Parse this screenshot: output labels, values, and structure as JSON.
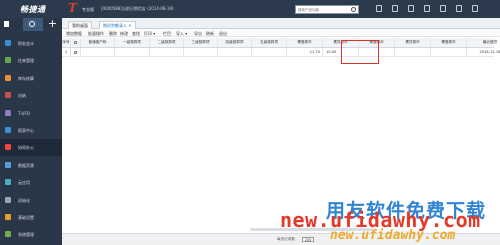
{
  "app": {
    "logo_text": "畅捷通",
    "logo_mark": "T",
    "edition": "专业版",
    "account_info": "[0000588]当前日期用友  (2014-08-19)"
  },
  "search": {
    "placeholder": "搜索产品功能"
  },
  "sidebar": {
    "items": [
      {
        "label": "财务会计",
        "color": "#3c8fd6"
      },
      {
        "label": "往来管理",
        "color": "#6aa84f"
      },
      {
        "label": "库存核算",
        "color": "#e69138"
      },
      {
        "label": "出纳",
        "color": "#c94e4e"
      },
      {
        "label": "T-UFO",
        "color": "#8e7cc3"
      },
      {
        "label": "报表中心",
        "color": "#3c8fd6"
      },
      {
        "label": "协同办公",
        "color": "#ee4444"
      },
      {
        "label": "数据资源",
        "color": "#5b9bd5"
      },
      {
        "label": "云应用",
        "color": "#4bacc6"
      },
      {
        "label": "初始化",
        "color": "#9aa6b2"
      },
      {
        "label": "基础设置",
        "color": "#e0a020"
      },
      {
        "label": "系统管理",
        "color": "#70ad47"
      }
    ]
  },
  "tabs": [
    {
      "label": "我的桌面",
      "active": false
    },
    {
      "label": "期初余额录入 ×",
      "active": true
    }
  ],
  "toolbar": {
    "items": [
      "增加数据",
      "批量操作",
      "删除",
      "修改",
      "查找",
      "打印 ▾",
      "栏目",
      "导入 ▾",
      "导出",
      "刷新",
      "退出"
    ]
  },
  "table": {
    "headers": [
      "序号",
      "",
      "普通客户码",
      "一级核算项",
      "二级核算项",
      "三级核算项",
      "四级核算项",
      "五级核算项",
      "累借原币",
      "累贷原币",
      "累借原币",
      "累贷原币",
      "累借原币",
      "最近借贷"
    ],
    "rows": [
      [
        "1",
        "",
        "",
        "",
        "",
        "",
        "",
        "",
        "11.70",
        "10.00",
        "",
        "",
        "",
        "2016-12-16"
      ]
    ]
  },
  "footer": {
    "page_label": "每页记录数",
    "page_size": "200"
  },
  "watermark": {
    "line1": "用友软件免费下载",
    "line2": "new.ufidawhy.com",
    "line3": "new.ufidawhy.com"
  }
}
